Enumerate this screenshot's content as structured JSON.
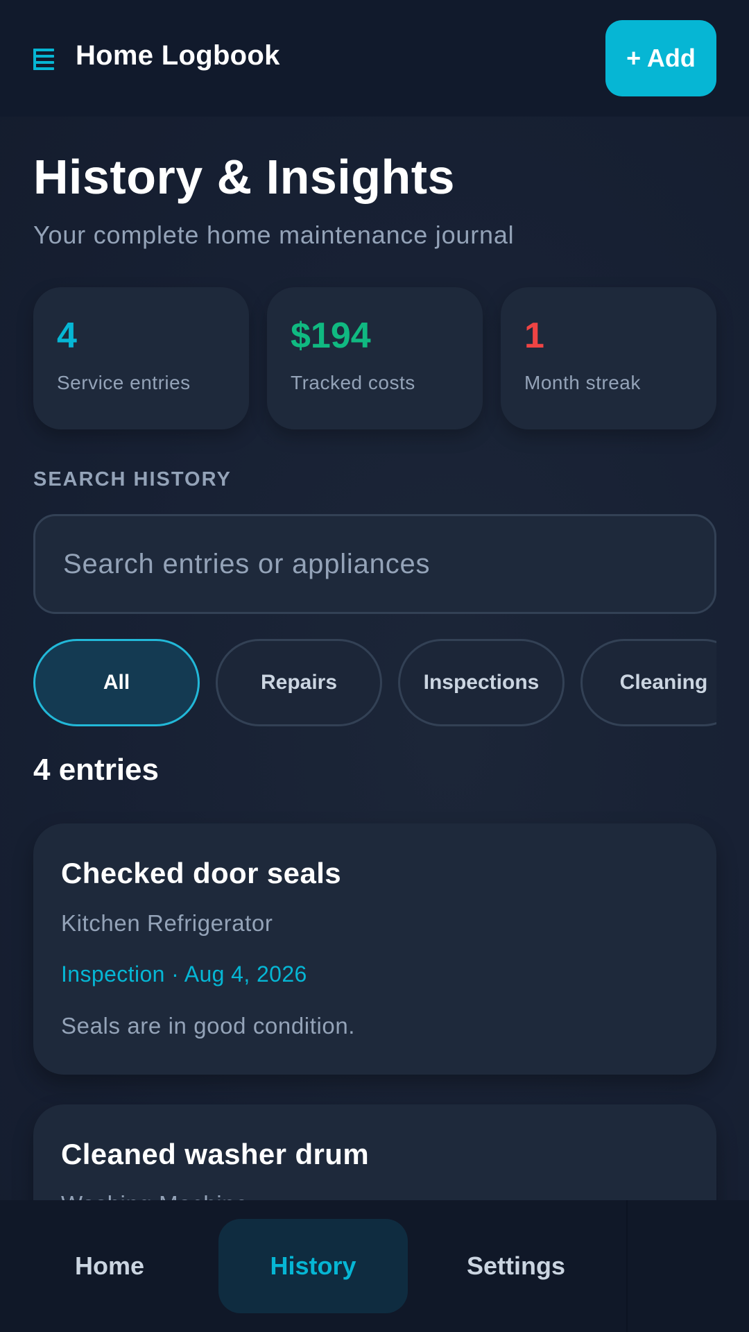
{
  "header": {
    "app_title": "Home Logbook",
    "logo_icon": "logbook-icon",
    "add_label": "+ Add"
  },
  "page": {
    "title": "History & Insights",
    "subtitle": "Your complete home maintenance journal"
  },
  "stats": [
    {
      "value": "4",
      "label": "Service entries",
      "color": "#06b6d4"
    },
    {
      "value": "$194",
      "label": "Tracked costs",
      "color": "#10b981"
    },
    {
      "value": "1",
      "label": "Month streak",
      "color": "#ef4444"
    }
  ],
  "search": {
    "section_label": "SEARCH HISTORY",
    "placeholder": "Search entries or appliances",
    "value": ""
  },
  "filters": {
    "selected": "All",
    "chips": [
      "All",
      "Repairs",
      "Inspections",
      "Cleaning"
    ]
  },
  "entries": {
    "count_label": "4 entries",
    "items": [
      {
        "title": "Checked door seals",
        "appliance": "Kitchen Refrigerator",
        "meta": "Inspection · Aug 4, 2026",
        "note": "Seals are in good condition."
      },
      {
        "title": "Cleaned washer drum",
        "appliance": "Washing Machine",
        "meta": "",
        "note": ""
      }
    ]
  },
  "nav": {
    "items": [
      "Home",
      "History",
      "Settings"
    ],
    "active": "History"
  },
  "colors": {
    "accent": "#06b6d4",
    "background": "#172033",
    "card": "#1e293b",
    "success": "#10b981",
    "danger": "#ef4444"
  }
}
